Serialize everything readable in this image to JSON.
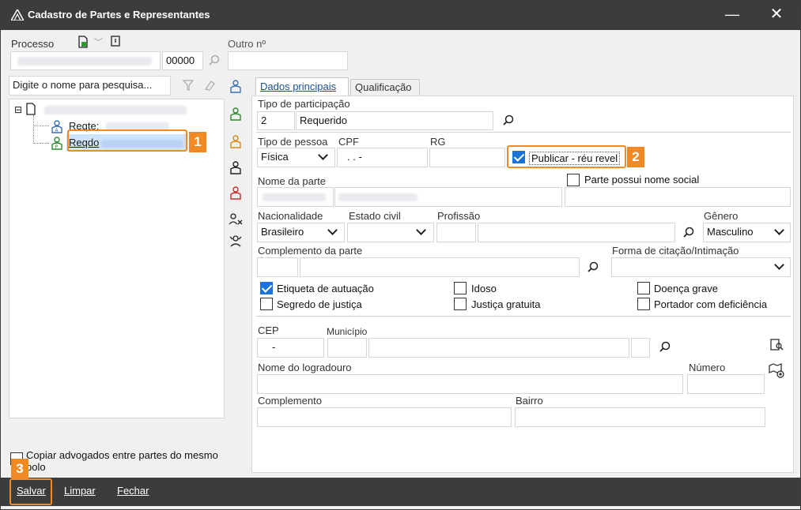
{
  "window": {
    "title": "Cadastro de Partes e Representantes",
    "minimize": "—",
    "close": "✕"
  },
  "header": {
    "processo_label": "Processo",
    "processo_suffix": "00000",
    "outro_label": "Outro nº"
  },
  "tree": {
    "search_placeholder": "Digite o nome para pesquisa...",
    "root_icon": "document-icon",
    "items": [
      {
        "label": "Reqte:"
      },
      {
        "label": "Reqdo"
      }
    ]
  },
  "tabs": [
    {
      "label": "Dados principais"
    },
    {
      "label": "Qualificação"
    }
  ],
  "form": {
    "tipo_participacao_label": "Tipo de participação",
    "tipo_participacao_code": "2",
    "tipo_participacao_value": "Requerido",
    "tipo_pessoa_label": "Tipo de pessoa",
    "tipo_pessoa_value": "Física",
    "cpf_label": "CPF",
    "cpf_value": ". . -",
    "rg_label": "RG",
    "publicar_label": "Publicar - réu revel",
    "nome_parte_label": "Nome da parte",
    "nome_social_label": "Parte possui nome social",
    "nacionalidade_label": "Nacionalidade",
    "nacionalidade_value": "Brasileiro",
    "estado_civil_label": "Estado civil",
    "profissao_label": "Profissão",
    "genero_label": "Gênero",
    "genero_value": "Masculino",
    "complemento_parte_label": "Complemento da parte",
    "forma_citacao_label": "Forma de citação/Intimação",
    "etiqueta_label": "Etiqueta de autuação",
    "idoso_label": "Idoso",
    "doenca_label": "Doença grave",
    "segredo_label": "Segredo de justiça",
    "justica_label": "Justiça gratuita",
    "portador_label": "Portador com deficiência",
    "cep_label": "CEP",
    "cep_value": "-",
    "municipio_label": "Município",
    "logradouro_label": "Nome do logradouro",
    "numero_label": "Número",
    "complemento_label": "Complemento",
    "bairro_label": "Bairro"
  },
  "copiar_label": "Copiar advogados entre partes do mesmo polo",
  "bottom": {
    "salvar": "Salvar",
    "limpar": "Limpar",
    "fechar": "Fechar"
  },
  "callouts": [
    "1",
    "2",
    "3"
  ],
  "colors": {
    "titlebar": "#3c3c3c",
    "accent": "#1a73d8",
    "callout": "#f08a24",
    "person_icon_blue": "#3b6fb6",
    "person_icon_green": "#2e8b2e",
    "person_icon_orange": "#d98a14",
    "person_icon_red": "#cc2a2a"
  }
}
